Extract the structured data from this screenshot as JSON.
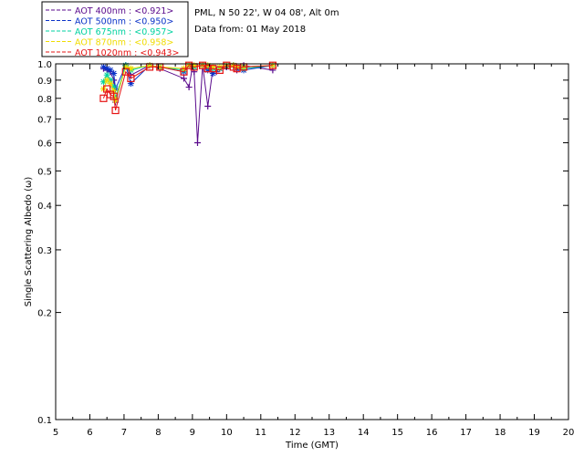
{
  "chart_data": {
    "type": "scatter",
    "title": "PML, N 50 22', W 04 08', Alt 0m",
    "subtitle": "Data from: 01 May 2018",
    "xlabel": "Time (GMT)",
    "ylabel": "Single Scattering Albedo (ω)",
    "xlim": [
      5,
      20
    ],
    "ylim": [
      0.1,
      1.0
    ],
    "yscale": "log",
    "x_ticks": [
      "5",
      "6",
      "7",
      "8",
      "9",
      "10",
      "11",
      "12",
      "13",
      "14",
      "15",
      "16",
      "17",
      "18",
      "19",
      "20"
    ],
    "y_ticks": [
      {
        "v": 1.0,
        "label": "1.0"
      },
      {
        "v": 0.9,
        "label": "0.9"
      },
      {
        "v": 0.8,
        "label": "0.8"
      },
      {
        "v": 0.7,
        "label": "0.7"
      },
      {
        "v": 0.6,
        "label": "0.6"
      },
      {
        "v": 0.5,
        "label": "0.5"
      },
      {
        "v": 0.4,
        "label": "0.4"
      },
      {
        "v": 0.3,
        "label": "0.3"
      },
      {
        "v": 0.2,
        "label": "0.2"
      },
      {
        "v": 0.1,
        "label": "0.1"
      }
    ],
    "legend_position": "top-left, above plot",
    "series": [
      {
        "name": "AOT  400nm : <0.921>",
        "color": "#5a0a8c",
        "marker": "plus",
        "x": [
          6.4,
          6.5,
          6.6,
          6.7,
          6.75,
          7.05,
          7.2,
          7.75,
          8.05,
          8.75,
          8.9,
          9.0,
          9.05,
          9.15,
          9.3,
          9.45,
          9.6,
          9.7,
          9.8,
          10.0,
          10.2,
          10.3,
          10.5,
          11.35
        ],
        "y": [
          0.97,
          0.96,
          0.95,
          0.9,
          0.78,
          0.99,
          0.93,
          0.99,
          0.97,
          0.91,
          0.86,
          0.98,
          0.95,
          0.6,
          0.99,
          0.76,
          0.97,
          0.95,
          0.97,
          0.98,
          0.99,
          0.96,
          0.99,
          0.96
        ]
      },
      {
        "name": "AOT  500nm : <0.950>",
        "color": "#0a32c8",
        "marker": "star",
        "x": [
          6.4,
          6.5,
          6.6,
          6.7,
          6.75,
          7.05,
          7.2,
          7.75,
          8.05,
          8.75,
          8.9,
          9.05,
          9.3,
          9.45,
          9.6,
          9.8,
          10.0,
          10.2,
          10.3,
          10.5,
          11.35
        ],
        "y": [
          0.98,
          0.97,
          0.96,
          0.94,
          0.85,
          0.99,
          0.88,
          0.99,
          0.98,
          0.95,
          0.99,
          0.98,
          0.99,
          0.96,
          0.94,
          0.97,
          0.98,
          0.99,
          0.97,
          0.96,
          0.99
        ]
      },
      {
        "name": "AOT  675nm : <0.957>",
        "color": "#00d2a0",
        "marker": "star",
        "x": [
          6.4,
          6.5,
          6.6,
          6.7,
          6.75,
          7.05,
          7.2,
          7.75,
          8.05,
          8.75,
          8.9,
          9.05,
          9.3,
          9.45,
          9.6,
          9.8,
          10.0,
          10.2,
          10.3,
          10.5,
          11.35
        ],
        "y": [
          0.89,
          0.93,
          0.9,
          0.86,
          0.8,
          0.99,
          0.96,
          0.99,
          0.98,
          0.96,
          0.99,
          0.98,
          0.99,
          0.98,
          0.97,
          0.97,
          0.99,
          0.99,
          0.98,
          0.97,
          0.99
        ]
      },
      {
        "name": "AOT  870nm : <0.958>",
        "color": "#f0dc00",
        "marker": "star",
        "x": [
          6.4,
          6.5,
          6.6,
          6.7,
          6.75,
          7.05,
          7.2,
          7.75,
          8.05,
          8.75,
          8.9,
          9.05,
          9.3,
          9.45,
          9.6,
          9.8,
          10.0,
          10.2,
          10.3,
          10.5,
          11.35
        ],
        "y": [
          0.85,
          0.9,
          0.88,
          0.84,
          0.79,
          0.98,
          0.97,
          0.99,
          0.98,
          0.97,
          0.99,
          0.99,
          0.99,
          0.99,
          0.98,
          0.98,
          0.99,
          0.99,
          0.98,
          0.98,
          0.99
        ]
      },
      {
        "name": "AOT 1020nm : <0.943>",
        "color": "#e61414",
        "marker": "square",
        "x": [
          6.4,
          6.5,
          6.6,
          6.7,
          6.75,
          7.05,
          7.2,
          7.75,
          8.05,
          8.75,
          8.9,
          9.05,
          9.3,
          9.45,
          9.6,
          9.8,
          10.0,
          10.2,
          10.3,
          10.5,
          11.35
        ],
        "y": [
          0.8,
          0.85,
          0.82,
          0.81,
          0.74,
          0.95,
          0.91,
          0.98,
          0.98,
          0.95,
          0.99,
          0.98,
          0.99,
          0.97,
          0.97,
          0.96,
          0.99,
          0.98,
          0.97,
          0.98,
          0.99
        ]
      }
    ]
  }
}
